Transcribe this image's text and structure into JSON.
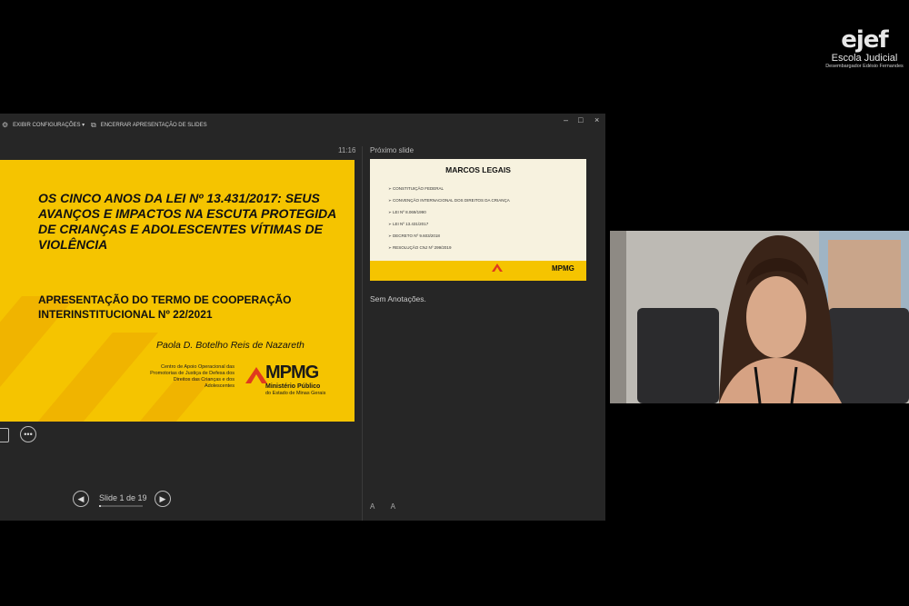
{
  "logo": {
    "name": "ejef",
    "line1": "Escola Judicial",
    "line2": "Desembargador Edésio Fernandes"
  },
  "toolbar": {
    "settings": "EXIBIR CONFIGURAÇÕES ▾",
    "end_show": "ENCERRAR APRESENTAÇÃO DE SLIDES"
  },
  "window_controls": [
    "–",
    "□",
    "×"
  ],
  "clock": "11:16",
  "current_slide": {
    "title": "OS CINCO ANOS DA LEI Nº 13.431/2017: SEUS AVANÇOS E IMPACTOS NA ESCUTA PROTEGIDA DE CRIANÇAS E ADOLESCENTES VÍTIMAS DE VIOLÊNCIA",
    "subtitle": "APRESENTAÇÃO DO TERMO DE COOPERAÇÃO INTERINSTITUCIONAL Nº 22/2021",
    "author": "Paola D. Botelho Reis de Nazareth",
    "caop": "Centro de Apoio Operacional das Promotorias de Justiça de Defesa dos Direitos das Crianças e dos Adolescentes",
    "org_logo": "MPMG",
    "org_line1": "Ministério Público",
    "org_line2": "do Estado de Minas Gerais",
    "accent": "#f5c400"
  },
  "nav": {
    "counter": "Slide 1 de 19",
    "progress": 0.05
  },
  "next_slide": {
    "label": "Próximo slide",
    "title": "MARCOS LEGAIS",
    "items": [
      "➢ CONSTITUIÇÃO FEDERAL",
      "➢ CONVENÇÃO INTERNACIONAL DOS DIREITOS DA CRIANÇA",
      "➢ LEI Nº 8.069/1990",
      "➢ LEI Nº 13.431/2017",
      "➢ DECRETO Nº 9.603/2018",
      "➢ RESOLUÇÃO CNJ Nº 299/2019"
    ],
    "org_logo": "MPMG"
  },
  "notes": "Sem Anotações.",
  "font_buttons": "A A"
}
